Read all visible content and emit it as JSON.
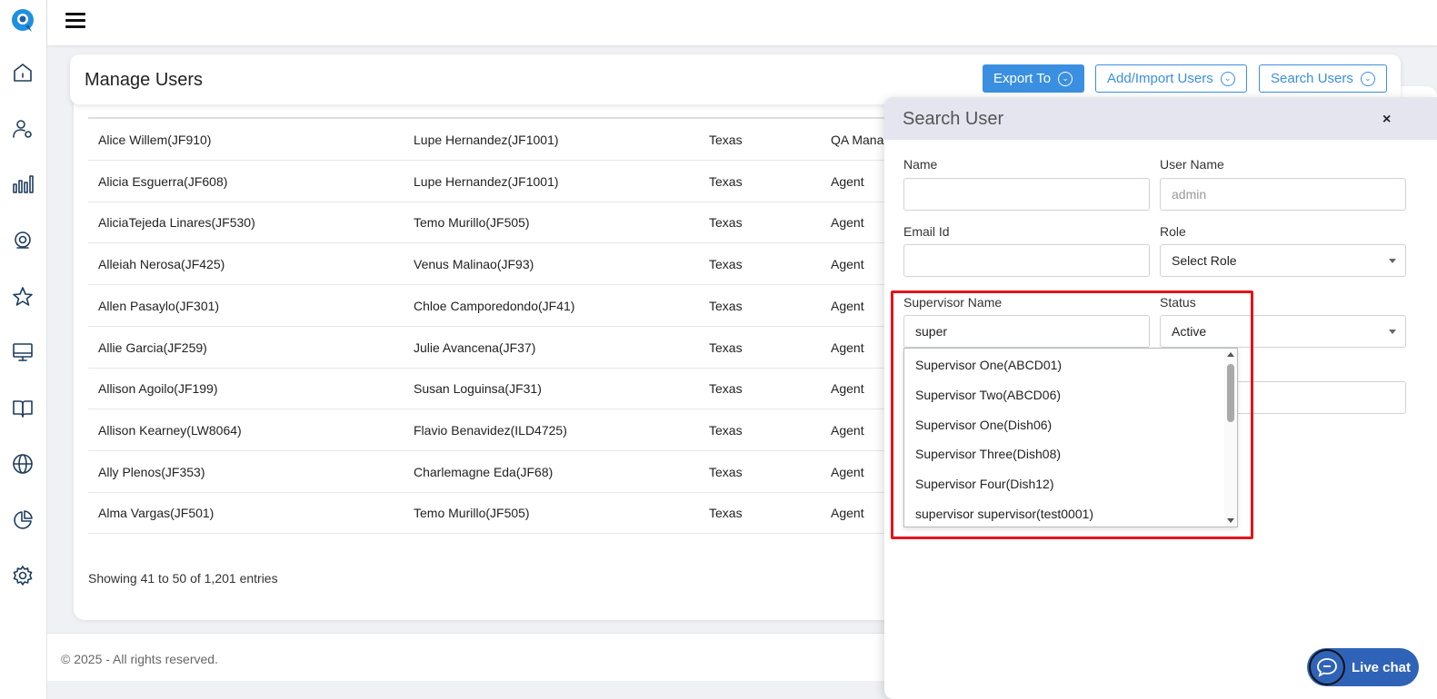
{
  "header": {
    "title": "Manage Users",
    "export_label": "Export To",
    "add_import_label": "Add/Import Users",
    "search_users_label": "Search Users"
  },
  "table": {
    "rows": [
      {
        "name": "Alice Willem(JF910)",
        "supervisor": "Lupe Hernandez(JF1001)",
        "location": "Texas",
        "role": "QA Mana"
      },
      {
        "name": "Alicia Esguerra(JF608)",
        "supervisor": "Lupe Hernandez(JF1001)",
        "location": "Texas",
        "role": "Agent"
      },
      {
        "name": "AliciaTejeda Linares(JF530)",
        "supervisor": "Temo Murillo(JF505)",
        "location": "Texas",
        "role": "Agent"
      },
      {
        "name": "Alleiah Nerosa(JF425)",
        "supervisor": "Venus Malinao(JF93)",
        "location": "Texas",
        "role": "Agent"
      },
      {
        "name": "Allen Pasaylo(JF301)",
        "supervisor": "Chloe Camporedondo(JF41)",
        "location": "Texas",
        "role": "Agent"
      },
      {
        "name": "Allie Garcia(JF259)",
        "supervisor": "Julie Avancena(JF37)",
        "location": "Texas",
        "role": "Agent"
      },
      {
        "name": "Allison Agoilo(JF199)",
        "supervisor": "Susan Loguinsa(JF31)",
        "location": "Texas",
        "role": "Agent"
      },
      {
        "name": "Allison Kearney(LW8064)",
        "supervisor": "Flavio Benavidez(ILD4725)",
        "location": "Texas",
        "role": "Agent"
      },
      {
        "name": "Ally Plenos(JF353)",
        "supervisor": "Charlemagne Eda(JF68)",
        "location": "Texas",
        "role": "Agent"
      },
      {
        "name": "Alma Vargas(JF501)",
        "supervisor": "Temo Murillo(JF505)",
        "location": "Texas",
        "role": "Agent"
      }
    ],
    "showing": "Showing 41 to 50 of 1,201 entries"
  },
  "footer": {
    "copyright": "© 2025 - All rights reserved."
  },
  "search_panel": {
    "title": "Search User",
    "close": "×",
    "name_label": "Name",
    "name_value": "",
    "username_label": "User Name",
    "username_placeholder": "admin",
    "email_label": "Email Id",
    "email_value": "",
    "role_label": "Role",
    "role_value": "Select Role",
    "supervisor_label": "Supervisor Name",
    "supervisor_value": "super",
    "status_label": "Status",
    "status_value": "Active",
    "suggestions": [
      "Supervisor One(ABCD01)",
      "Supervisor Two(ABCD06)",
      "Supervisor One(Dish06)",
      "Supervisor Three(Dish08)",
      "Supervisor Four(Dish12)",
      "supervisor supervisor(test0001)"
    ]
  },
  "live_chat": {
    "label": "Live chat"
  },
  "colors": {
    "accent": "#3b8fe0",
    "highlight": "#e5131b",
    "chat": "#2f63b8"
  }
}
